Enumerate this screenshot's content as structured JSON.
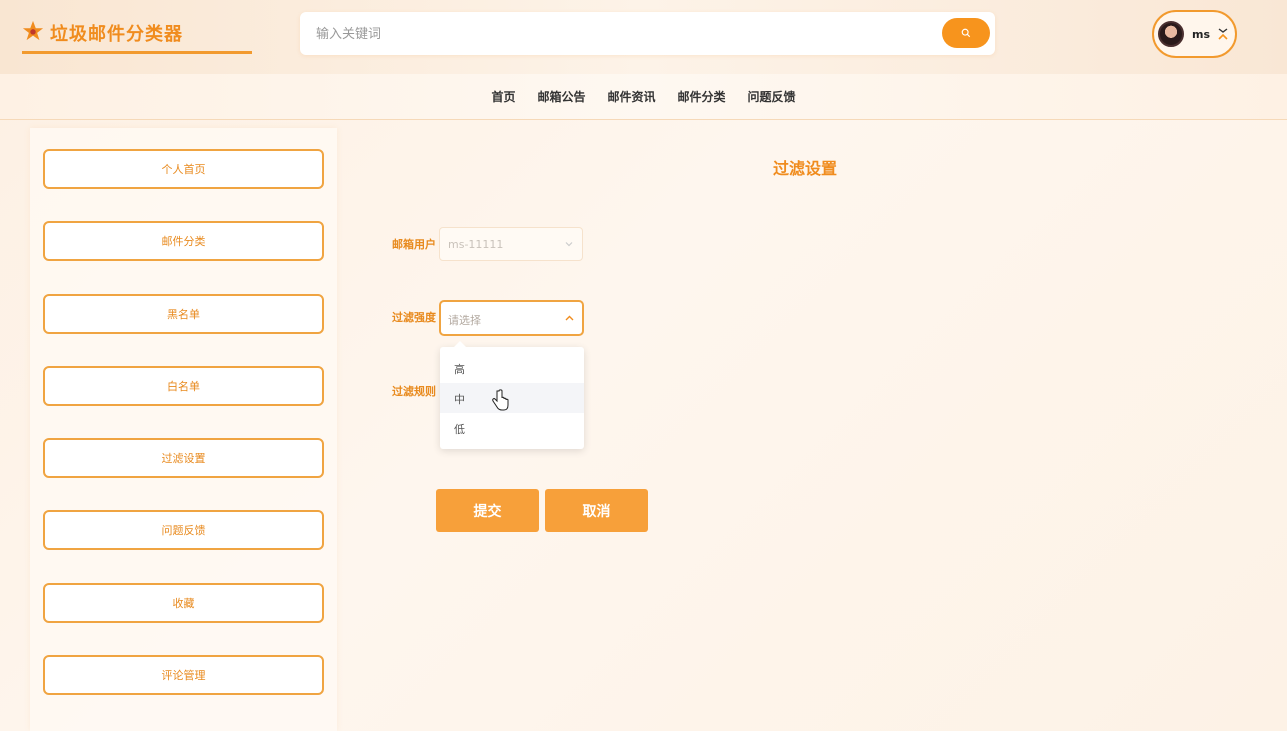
{
  "app": {
    "title": "垃圾邮件分类器"
  },
  "search": {
    "placeholder": "输入关键词"
  },
  "user": {
    "name": "ms"
  },
  "nav": [
    "首页",
    "邮箱公告",
    "邮件资讯",
    "邮件分类",
    "问题反馈"
  ],
  "sidebar": [
    "个人首页",
    "邮件分类",
    "黑名单",
    "白名单",
    "过滤设置",
    "问题反馈",
    "收藏",
    "评论管理"
  ],
  "page": {
    "title": "过滤设置"
  },
  "form": {
    "user_label": "邮箱用户",
    "user_value": "ms-11111",
    "strength_label": "过滤强度",
    "strength_placeholder": "请选择",
    "rule_label": "过滤规则",
    "strength_options": [
      "高",
      "中",
      "低"
    ],
    "hovered_option": "中"
  },
  "buttons": {
    "submit": "提交",
    "cancel": "取消"
  },
  "colors": {
    "accent": "#f7941d",
    "border": "#f0a441",
    "label": "#e88a1e"
  }
}
